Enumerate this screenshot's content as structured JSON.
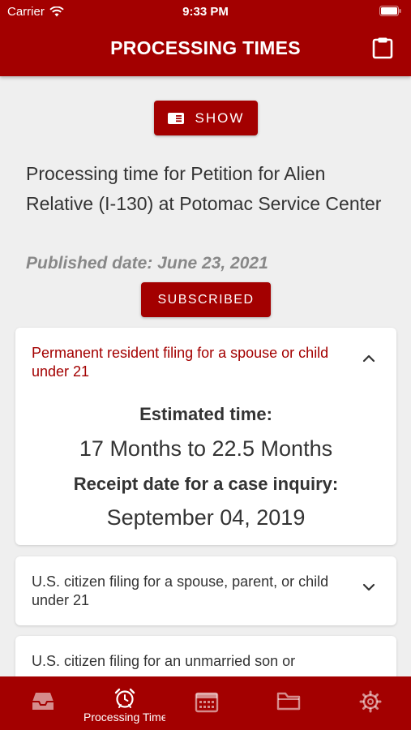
{
  "status_bar": {
    "carrier": "Carrier",
    "time": "9:33 PM"
  },
  "header": {
    "title": "PROCESSING TIMES",
    "action_icon": "clipboard-icon"
  },
  "show_button": {
    "label": "SHOW",
    "icon": "card-icon"
  },
  "heading": "Processing time for Petition for Alien Relative (I-130) at Potomac Service Center",
  "published_date": "Published date: June 23, 2021",
  "subscribe_button": {
    "label": "SUBSCRIBED"
  },
  "cards": [
    {
      "title": "Permanent resident filing for a spouse or child under 21",
      "expanded": true,
      "estimated_label": "Estimated time:",
      "estimated_value": "17 Months to 22.5 Months",
      "receipt_label": "Receipt date for a case inquiry:",
      "receipt_value": "September 04, 2019"
    },
    {
      "title": "U.S. citizen filing for a spouse, parent, or child under 21",
      "expanded": false
    },
    {
      "title": "U.S. citizen filing for an unmarried son or",
      "expanded": false
    }
  ],
  "tabbar": {
    "tabs": [
      {
        "label": "",
        "icon": "inbox-icon"
      },
      {
        "label": "Processing Times",
        "icon": "alarm-clock-icon",
        "active": true
      },
      {
        "label": "",
        "icon": "calendar-icon"
      },
      {
        "label": "",
        "icon": "folder-icon"
      },
      {
        "label": "",
        "icon": "gear-icon"
      }
    ]
  },
  "colors": {
    "brand": "#a30000",
    "background": "#efefef",
    "card": "#ffffff",
    "muted_text": "#888888"
  }
}
